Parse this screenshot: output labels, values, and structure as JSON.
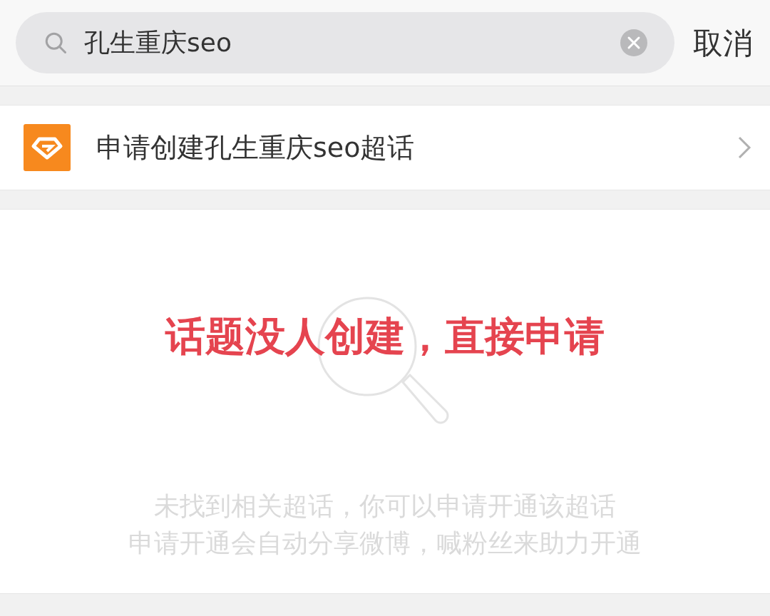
{
  "search": {
    "value": "孔生重庆seo",
    "cancel": "取消"
  },
  "result": {
    "label": "申请创建孔生重庆seo超话"
  },
  "annotation": "话题没人创建，直接申请",
  "empty_state": {
    "lines": [
      "未找到相关超话，你可以申请开通该超话",
      "申请开通会自动分享微博，喊粉丝来助力开通"
    ]
  }
}
